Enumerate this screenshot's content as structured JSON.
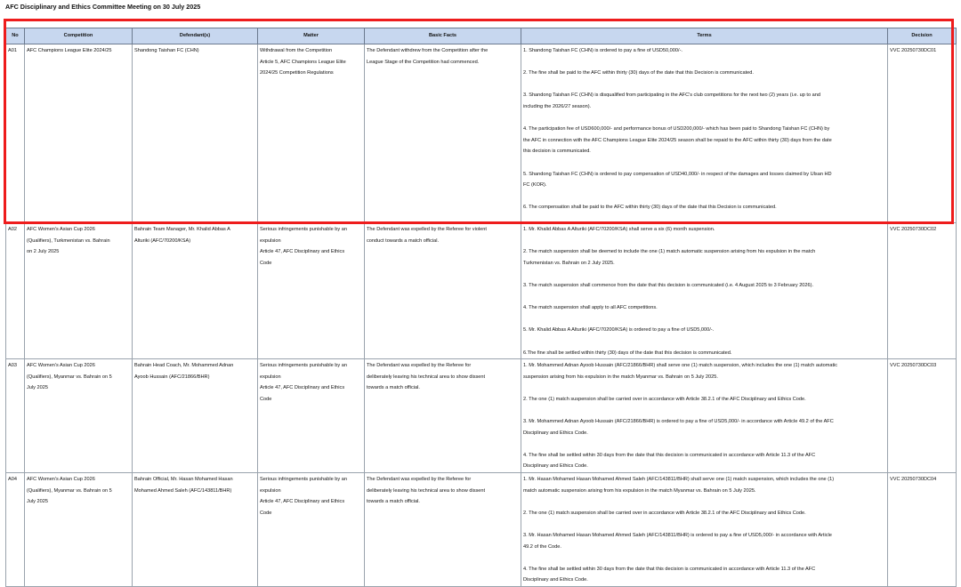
{
  "page_title": "AFC Disciplinary and Ethics Committee Meeting on 30 July 2025",
  "columns": [
    "No",
    "Competition",
    "Defendant(s)",
    "Matter",
    "Basic Facts",
    "Terms",
    "Decision"
  ],
  "rows": [
    {
      "no": "A01",
      "competition": [
        "AFC Champions League Elite 2024/25"
      ],
      "defendant": [
        "Shandong Taishan FC (CHN)"
      ],
      "matter": [
        "Withdrawal from the Competition",
        "Article 5, AFC Champions League Elite",
        "2024/25 Competition Regulations"
      ],
      "facts": [
        "The Defendant withdrew from the Competition after the",
        "League Stage of the Competition had commenced."
      ],
      "terms": [
        [
          "1. Shandong Taishan FC (CHN) is ordered to pay a fine of USD50,000/-."
        ],
        [
          "2. The fine shall be paid to the AFC within thirty (30) days of the date that this Decision is communicated."
        ],
        [
          "3. Shandong Taishan FC (CHN) is disqualified from participating in the AFC's club competitions for the next two (2) years (i.e. up to and",
          "including the 2026/27 season)."
        ],
        [
          "4. The participation fee of USD600,000/- and performance bonus of USD200,000/- which has been paid to Shandong Taishan FC (CHN) by",
          "the AFC in connection with the AFC Champions League Elite 2024/25 season shall be repaid to the AFC within thirty (30) days from the date",
          "this decision is communicated."
        ],
        [
          "5. Shandong Taishan FC (CHN) is ordered to pay compensation of USD40,000/- in respect of the damages and losses claimed by Ulsan HD",
          "FC (KOR)."
        ],
        [
          "6. The compensation shall be paid to the AFC within thirty (30) days of the date that this Decision is communicated."
        ]
      ],
      "decision": "VVC 20250730DC01"
    },
    {
      "no": "A02",
      "competition": [
        "AFC Women's Asian Cup 2026",
        "(Qualifiers), Turkmenistan vs. Bahrain",
        "on 2 July 2025"
      ],
      "defendant": [
        "Bahrain Team Manager, Mr. Khalid Abbas A",
        "Alturiki (AFC/70200/KSA)"
      ],
      "matter": [
        "Serious infringements punishable by an",
        "expulsion",
        "Article 47, AFC Disciplinary and Ethics",
        "Code"
      ],
      "facts": [
        "The Defendant was expelled by the Referee for violent",
        "conduct towards a match official."
      ],
      "terms": [
        [
          "1. Mr. Khalid Abbas A Alturiki (AFC/70200/KSA) shall serve a six (6) month suspension."
        ],
        [
          "2. The match suspension shall be deemed to include the one (1) match automatic suspension arising from his expulsion in the match",
          "Turkmenistan vs. Bahrain on 2 July 2025."
        ],
        [
          "3. The match suspension shall commence from the date that this decision is communicated (i.e. 4 August 2025 to 3 February 2026)."
        ],
        [
          "4. The match suspension shall apply to all AFC competitions."
        ],
        [
          "5. Mr. Khalid Abbas A Alturiki (AFC/70200/KSA) is ordered to pay a fine of USD5,000/-."
        ],
        [
          "6.The fine shall be settled within thirty (30) days of the date that this decision is communicated."
        ]
      ],
      "decision": "VVC 20250730DC02"
    },
    {
      "no": "A03",
      "competition": [
        "AFC Women's Asian Cup 2026",
        "(Qualifiers), Myanmar vs. Bahrain on 5",
        "July 2025"
      ],
      "defendant": [
        "Bahrain Head Coach, Mr. Mohammed Adnan",
        "Ayoob Hussain (AFC/21866/BHR)"
      ],
      "matter": [
        "Serious infringements punishable by an",
        "expulsion",
        "Article 47, AFC Disciplinary and Ethics",
        "Code"
      ],
      "facts": [
        "The Defendant was expelled by the Referee for",
        "deliberately leaving his technical area to show dissent",
        "towards a match official."
      ],
      "terms": [
        [
          "1. Mr. Mohammed Adnan Ayoob Hussain (AFC/21866/BHR) shall serve one (1) match suspension, which includes the one (1) match automatic",
          "suspension arising from his expulsion in the match Myanmar vs. Bahrain on 5 July 2025."
        ],
        [
          "2. The one (1) match suspension shall be carried over in accordance with Article 38.2.1 of the AFC Disciplinary and Ethics Code."
        ],
        [
          "3. Mr. Mohammed Adnan Ayoob Hussain (AFC/21866/BHR) is ordered to pay a fine of USD5,000/- in accordance with Article 49.2 of the AFC",
          "Disciplinary and Ethics Code."
        ],
        [
          "4. The fine shall be settled within 30 days from the date that this decision is communicated in accordance with Article 11.3 of the AFC",
          "Disciplinary and Ethics Code."
        ]
      ],
      "decision": "VVC 20250730DC03"
    },
    {
      "no": "A04",
      "competition": [
        "AFC Women's Asian Cup 2026",
        "(Qualifiers), Myanmar vs. Bahrain on 5",
        "July 2025"
      ],
      "defendant": [
        "Bahrain Official, Mr. Hasan Mohamed Hasan",
        "Mohamed Ahmed Saleh (AFC/143811/BHR)"
      ],
      "matter": [
        "Serious infringements punishable by an",
        "expulsion",
        "Article 47, AFC Disciplinary and Ethics",
        "Code"
      ],
      "facts": [
        "The Defendant was expelled by the Referee for",
        "deliberately leaving his technical area to show dissent",
        "towards a match official."
      ],
      "terms": [
        [
          "1. Mr. Hasan Mohamed Hasan Mohamed Ahmed Saleh (AFC/143811/BHR) shall serve one (1) match suspension, which includes the one (1)",
          "match automatic suspension arising from his expulsion in the match Myanmar vs. Bahrain on 5 July 2025."
        ],
        [
          "2. The one (1) match suspension shall be carried over in accordance with Article 38.2.1 of the AFC Disciplinary and Ethics Code."
        ],
        [
          "3. Mr. Hasan Mohamed Hasan Mohamed Ahmed Saleh (AFC/143811/BHR) is ordered to pay a fine of USD5,000/- in accordance with Article",
          "49.2 of the Code."
        ],
        [
          "4. The fine shall be settled within 30 days from the date that this decision is communicated in accordance with Article 11.3 of the AFC",
          "Disciplinary and Ethics Code."
        ]
      ],
      "decision": "VVC 20250730DC04"
    }
  ],
  "colors": {
    "header_fill": "#c7d7ef",
    "highlight": "#ee1c1c"
  }
}
